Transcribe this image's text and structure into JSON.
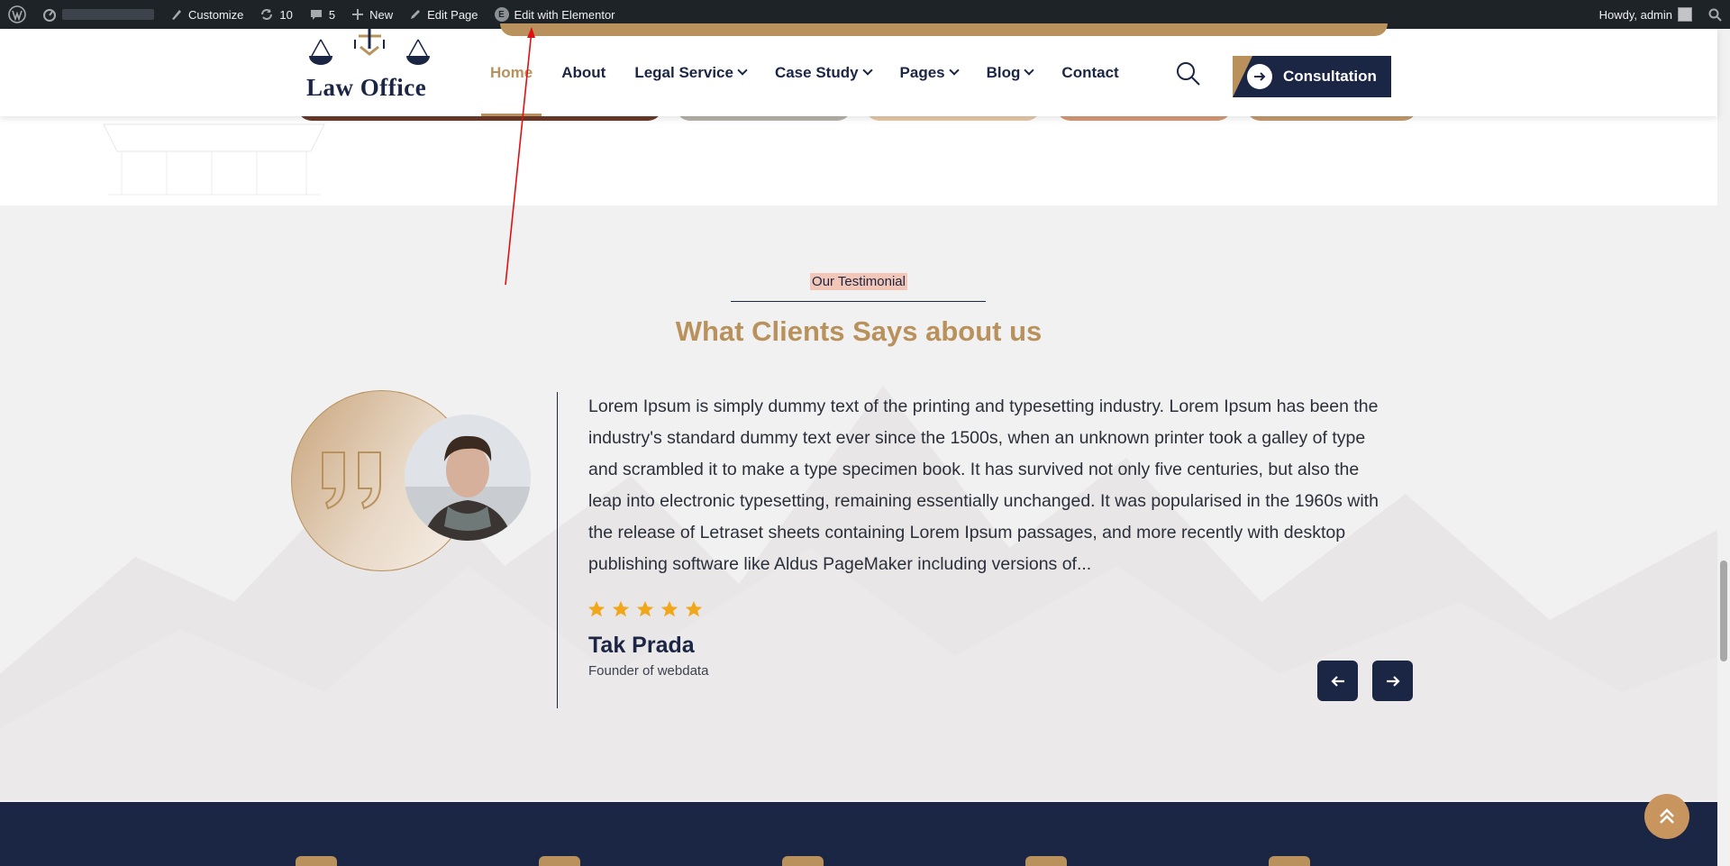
{
  "adminbar": {
    "customize": "Customize",
    "updates_count": "10",
    "comments_count": "5",
    "new_label": "New",
    "edit_page": "Edit Page",
    "edit_elementor": "Edit with Elementor",
    "howdy": "Howdy, admin"
  },
  "header": {
    "logo_text": "Law Office",
    "nav": [
      {
        "label": "Home",
        "active": true
      },
      {
        "label": "About"
      },
      {
        "label": "Legal Service",
        "dropdown": true
      },
      {
        "label": "Case Study",
        "dropdown": true
      },
      {
        "label": "Pages",
        "dropdown": true
      },
      {
        "label": "Blog",
        "dropdown": true
      },
      {
        "label": "Contact"
      }
    ],
    "consultation_label": "Consultation"
  },
  "testimonial": {
    "eyebrow": "Our Testimonial",
    "heading": "What Clients Says about us",
    "text": "Lorem Ipsum is simply dummy text of the printing and typesetting industry. Lorem Ipsum has been the industry's standard dummy text ever since the 1500s, when an unknown printer took a galley of type and scrambled it to make a type specimen book. It has survived not only five centuries, but also the leap into electronic typesetting, remaining essentially unchanged. It was popularised in the 1960s with the release of Letraset sheets containing Lorem Ipsum passages, and more recently with desktop publishing software like Aldus PageMaker including versions of...",
    "rating": 5,
    "name": "Tak Prada",
    "role": "Founder of webdata"
  },
  "colors": {
    "accent": "#b8915c",
    "navy": "#1b2544",
    "star": "#f2a71b",
    "section_bg": "#f2f1f1"
  }
}
